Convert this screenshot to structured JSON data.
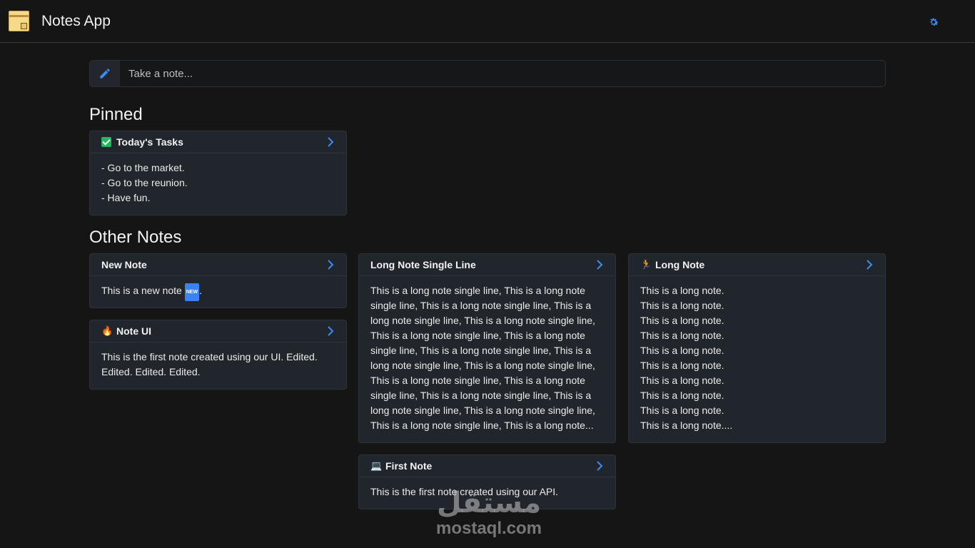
{
  "header": {
    "title": "Notes App",
    "logo_icon": "sticky-note-icon",
    "settings_icon": "gear-icon"
  },
  "composer": {
    "icon": "pencil-icon",
    "placeholder": "Take a note..."
  },
  "sections": {
    "pinned_title": "Pinned",
    "other_title": "Other Notes"
  },
  "notes": {
    "todays_tasks": {
      "title": "Today's Tasks",
      "emoji": "check-mark-icon",
      "lines": [
        "- Go to the market.",
        "- Go to the reunion.",
        "- Have fun."
      ]
    },
    "new_note": {
      "title": "New Note",
      "body_prefix": "This is a new note",
      "badge": "NEW",
      "body_suffix": "."
    },
    "note_ui": {
      "title": "Note UI",
      "emoji": "🔥",
      "lines": [
        "This is the first note created using our UI. Edited.",
        "Edited. Edited. Edited."
      ]
    },
    "long_single": {
      "title": "Long Note Single Line",
      "lines": [
        "This is a long note single line, This is a long note",
        "single line, This is a long note single line, This is a",
        "long note single line, This is a long note single line,",
        "This is a long note single line, This is a long note",
        "single line, This is a long note single line, This is a",
        "long note single line, This is a long note single line,",
        "This is a long note single line, This is a long note",
        "single line, This is a long note single line, This is a",
        "long note single line, This is a long note single line,",
        "This is a long note single line, This is a long note..."
      ]
    },
    "first_note": {
      "title": "First Note",
      "emoji": "💻",
      "lines": [
        "This is the first note created using our API."
      ]
    },
    "long_note": {
      "title": "Long Note",
      "emoji": "🏃",
      "lines": [
        "This is a long note.",
        "This is a long note.",
        "This is a long note.",
        "This is a long note.",
        "This is a long note.",
        "This is a long note.",
        "This is a long note.",
        "This is a long note.",
        "This is a long note.",
        "This is a long note...."
      ]
    }
  },
  "watermark": {
    "arabic": "مستقل",
    "latin": "mostaql.com"
  },
  "colors": {
    "accent": "#3b8cf0",
    "background": "#151515",
    "card": "#21252c"
  }
}
